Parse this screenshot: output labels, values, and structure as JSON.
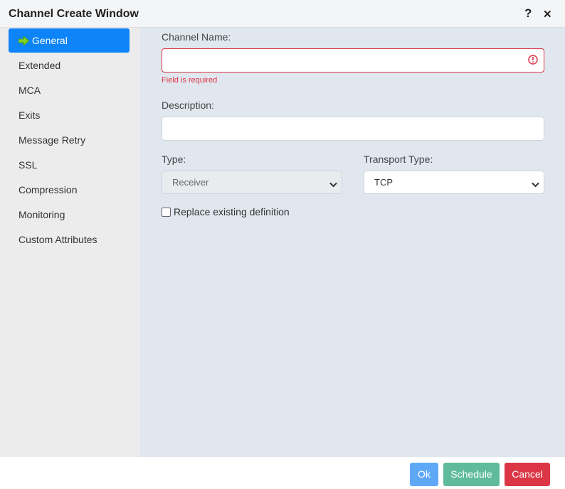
{
  "window": {
    "title": "Channel Create Window",
    "help_icon": "?",
    "close_icon": "✕"
  },
  "sidebar": {
    "items": [
      {
        "label": "General",
        "active": true,
        "icon": "green-arrow-icon"
      },
      {
        "label": "Extended"
      },
      {
        "label": "MCA"
      },
      {
        "label": "Exits"
      },
      {
        "label": "Message Retry"
      },
      {
        "label": "SSL"
      },
      {
        "label": "Compression"
      },
      {
        "label": "Monitoring"
      },
      {
        "label": "Custom Attributes"
      }
    ]
  },
  "form": {
    "channel_name": {
      "label": "Channel Name:",
      "value": "",
      "error": "Field is required"
    },
    "description": {
      "label": "Description:",
      "value": ""
    },
    "type": {
      "label": "Type:",
      "value": "Receiver",
      "disabled": true
    },
    "transport_type": {
      "label": "Transport Type:",
      "value": "TCP"
    },
    "replace_existing": {
      "label": "Replace existing definition",
      "checked": false
    }
  },
  "footer": {
    "ok_label": "Ok",
    "schedule_label": "Schedule",
    "cancel_label": "Cancel"
  },
  "colors": {
    "active_nav": "#0d84f7",
    "error": "#dc3545",
    "ok_button": "#5fa8f7",
    "schedule_button": "#5fbb9b",
    "cancel_button": "#dc3545"
  }
}
